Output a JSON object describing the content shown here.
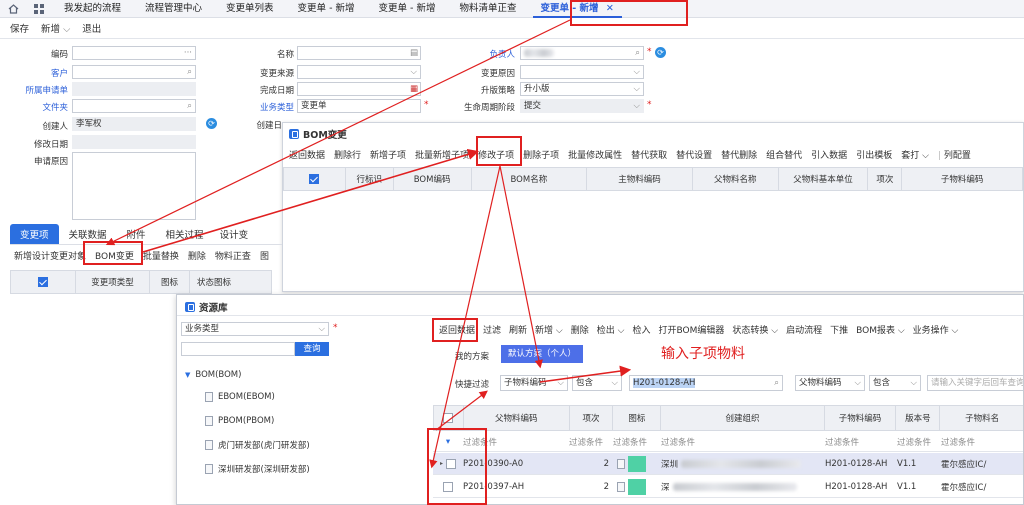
{
  "tabs": [
    {
      "label": "我发起的流程"
    },
    {
      "label": "流程管理中心"
    },
    {
      "label": "变更单列表"
    },
    {
      "label": "变更单 - 新增"
    },
    {
      "label": "变更单 - 新增"
    },
    {
      "label": "物料清单正查"
    },
    {
      "label": "变更单 - 新增",
      "active": true
    }
  ],
  "toolbar": {
    "save": "保存",
    "new": "新增",
    "exit": "退出"
  },
  "form": {
    "col1": {
      "code": "编码",
      "customer": "客户",
      "app_form": "所属申请单",
      "folder": "文件夹",
      "creator": "创建人",
      "creator_value": "李军权",
      "modify_date": "修改日期",
      "reason": "申请原因"
    },
    "col2": {
      "name": "名称",
      "source": "变更来源",
      "finish_date": "完成日期",
      "biz_type": "业务类型",
      "biz_type_value": "变更单",
      "create_date": "创建日"
    },
    "col3": {
      "owner": "负责人",
      "change_reason": "变更原因",
      "upgrade": "升版策略",
      "upgrade_value": "升小版",
      "lifecycle": "生命周期阶段",
      "lifecycle_value": "提交"
    }
  },
  "bom_panel": {
    "title": "BOM变更",
    "buttons": [
      "返回数据",
      "删除行",
      "新增子项",
      "批量新增子项",
      "修改子项",
      "删除子项",
      "批量修改属性",
      "替代获取",
      "替代设置",
      "替代删除",
      "组合替代",
      "引入数据",
      "引出模板",
      "套打",
      "列配置"
    ],
    "columns": [
      "",
      "行标识",
      "BOM编码",
      "BOM名称",
      "主物料编码",
      "父物料名称",
      "父物料基本单位",
      "项次",
      "子物料编码"
    ]
  },
  "bottom_tabs": [
    "变更项",
    "关联数据",
    "附件",
    "相关过程",
    "设计变"
  ],
  "bottom_buttons": [
    "新增设计变更对象",
    "BOM变更",
    "批量替换",
    "删除",
    "物料正查",
    "图"
  ],
  "bottom_columns": [
    "",
    "变更项类型",
    "图标",
    "状态图标"
  ],
  "resource": {
    "title": "资源库",
    "biz_select": "业务类型",
    "query": "查询",
    "tree_root": "BOM(BOM)",
    "tree_items": [
      "EBOM(EBOM)",
      "PBOM(PBOM)",
      "虎门研发部(虎门研发部)",
      "深圳研发部(深圳研发部)"
    ],
    "buttons": [
      "返回数据",
      "过滤",
      "刷新",
      "新增",
      "删除",
      "检出",
      "检入",
      "打开BOM编辑器",
      "状态转换",
      "启动流程",
      "下推",
      "BOM报表",
      "业务操作"
    ],
    "my_plan": "我的方案",
    "default_plan": "默认方案（个人）",
    "quick_filter": "快捷过滤",
    "field1": "子物料编码",
    "op1": "包含",
    "value1": "H201-0128-AH",
    "field2": "父物料编码",
    "op2": "包含",
    "placeholder2": "请输入关键字后回车查询",
    "annotation": "输入子项物料",
    "columns": [
      "",
      "父物料编码",
      "项次",
      "图标",
      "创建组织",
      "子物料编码",
      "版本号",
      "子物料名"
    ],
    "filter_text": "过滤条件",
    "rows": [
      {
        "parent": "P201-0390-A0",
        "seq": "2",
        "org": "深圳",
        "child": "H201-0128-AH",
        "ver": "V1.1",
        "name": "霍尔感应IC/"
      },
      {
        "parent": "P201-0397-AH",
        "seq": "2",
        "org": "深",
        "child": "H201-0128-AH",
        "ver": "V1.1",
        "name": "霍尔感应IC/"
      }
    ]
  },
  "colors": {
    "accent": "#2b5fd9",
    "red": "#e02020",
    "header": "#eef0f4"
  }
}
